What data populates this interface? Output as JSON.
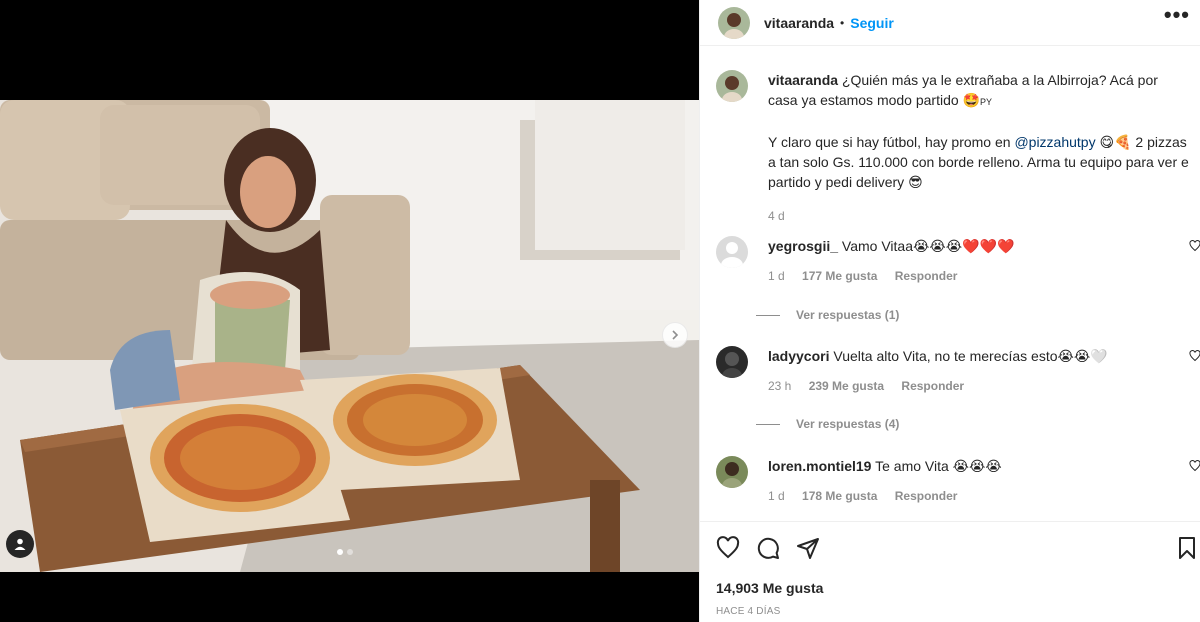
{
  "header": {
    "username": "vitaaranda",
    "separator": "•",
    "follow_label": "Seguir",
    "more_label": "•••"
  },
  "caption": {
    "username": "vitaaranda",
    "line1": "¿Quién más ya le extrañaba a la Albirroja? Acá por casa ya estamos modo partido 🤩",
    "flag": "PY",
    "line2a": "Y claro que si hay fútbol, hay promo en ",
    "mention": "@pizzahutpy",
    "line2b": " 😋🍕 2 pizzas a tan solo Gs. 110.000 con borde relleno. Arma tu equipo para ver e partido y pedi delivery 😎",
    "time": "4 d"
  },
  "comments": [
    {
      "username": "yegrosgii_",
      "text": "Vamo Vitaa😭😭😭❤️❤️❤️",
      "time": "1 d",
      "likes": "177 Me gusta",
      "reply": "Responder",
      "view_replies": "Ver respuestas (1)"
    },
    {
      "username": "ladyycori",
      "text": "Vuelta alto Vita, no te merecías esto😭😭🤍",
      "time": "23 h",
      "likes": "239 Me gusta",
      "reply": "Responder",
      "view_replies": "Ver respuestas (4)"
    },
    {
      "username": "loren.montiel19",
      "text": "Te amo Vita 😭😭😭",
      "time": "1 d",
      "likes": "178 Me gusta",
      "reply": "Responder"
    }
  ],
  "actions": {
    "likes": "14,903 Me gusta",
    "posted_ago": "HACE 4 DÍAS"
  },
  "colors": {
    "link": "#0095f6",
    "mention": "#00376b",
    "secondary_text": "#8e8e8e",
    "border": "#efefef"
  },
  "icons": [
    "heart-icon",
    "comment-icon",
    "share-icon",
    "bookmark-icon",
    "chevron-right-icon",
    "user-tag-icon"
  ]
}
